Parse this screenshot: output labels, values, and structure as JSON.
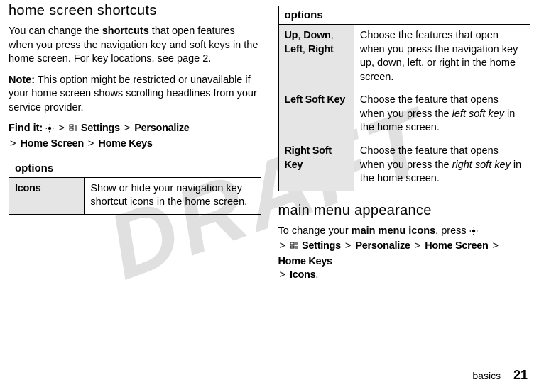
{
  "watermark": "DRAFT",
  "leftCol": {
    "heading": "home screen shortcuts",
    "para1_pre": "You can change the ",
    "para1_bold": "shortcuts",
    "para1_post": " that open features when you press the navigation key and soft keys in the home screen. For key locations, see page 2.",
    "note_label": "Note:",
    "note_body": " This option might be restricted or unavailable if your home screen shows scrolling headlines from your service provider.",
    "findit_label": "Find it:",
    "path": {
      "settings": "Settings",
      "personalize": "Personalize",
      "homescreen": "Home Screen",
      "homekeys": "Home Keys"
    },
    "table_header": "options",
    "row1_label": "Icons",
    "row1_desc": "Show or hide your navigation key shortcut icons in the home screen."
  },
  "rightTable": {
    "header": "options",
    "rows": [
      {
        "label_parts": [
          "Up",
          "Down",
          "Left",
          "Right"
        ],
        "label_joined": "Up, Down, Left, Right",
        "desc": "Choose the features that open when you press the navigation key up, down, left, or right in the home screen."
      },
      {
        "label": "Left Soft Key",
        "desc_pre": "Choose the feature that opens when you press the ",
        "desc_em": "left soft key",
        "desc_post": " in the home screen."
      },
      {
        "label": "Right Soft Key",
        "desc_pre": "Choose the feature that opens when you press the ",
        "desc_em": "right soft key",
        "desc_post": " in the home screen."
      }
    ]
  },
  "section2": {
    "heading": "main menu appearance",
    "para_pre": "To change your ",
    "para_bold": "main menu icons",
    "para_mid": ", press",
    "path": {
      "settings": "Settings",
      "personalize": "Personalize",
      "homescreen": "Home Screen",
      "homekeys": "Home Keys",
      "icons": "Icons"
    }
  },
  "footer": {
    "section": "basics",
    "page": "21"
  },
  "glyphs": {
    "gt": ">",
    "comma": ", ",
    "dot": "."
  }
}
